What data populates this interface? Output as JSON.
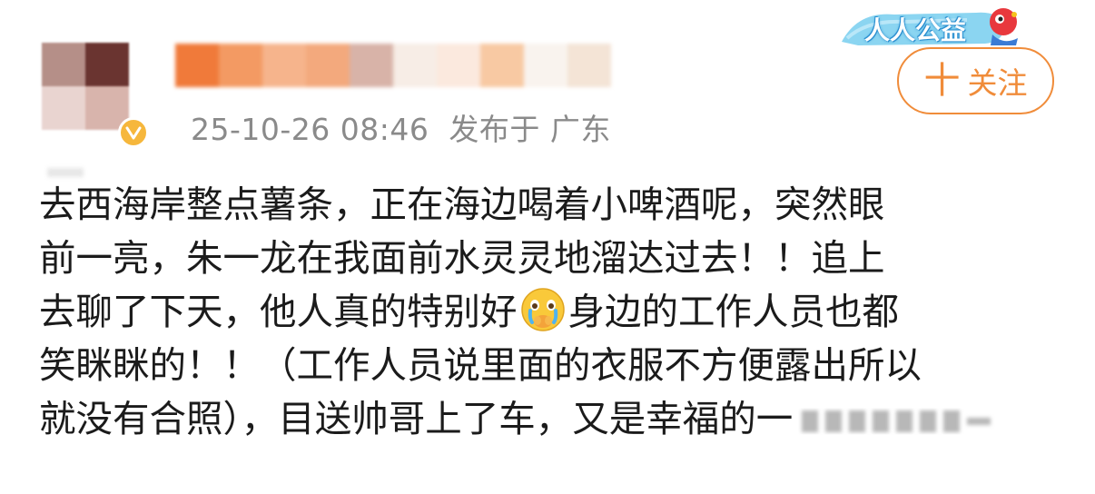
{
  "post": {
    "meta_time": "25-10-26 08:46",
    "meta_location": "发布于 广东",
    "lines": [
      "去西海岸整点薯条，正在海边喝着小啤酒呢，突然眼",
      "前一亮，朱一龙在我面前水灵灵地溜达过去！！追上",
      "去聊了下天，他人真的特别好",
      "身边的工作人员也都",
      "笑眯眯的！！（工作人员说里面的衣服不方便露出所以",
      "就没有合照），目送帅哥上了车，又是幸福的一"
    ]
  },
  "header": {
    "charity_label": "人人公益",
    "follow_label": "关注",
    "follow_plus": "十"
  },
  "icons": {
    "verified": "verified-badge-icon",
    "emoji": "crying-emoji-icon",
    "charity": "charity-mascot-icon"
  },
  "colors": {
    "accent": "#f08c3a",
    "meta": "#8a8a8a",
    "text": "#1b1b1b",
    "verified": "#f6b73c",
    "charity_blue": "#2a8fd0"
  }
}
